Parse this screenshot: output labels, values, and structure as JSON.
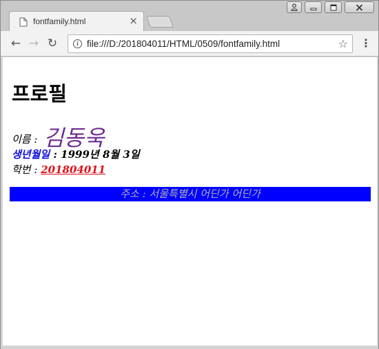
{
  "tab": {
    "title": "fontfamily.html",
    "close_icon": "close-icon"
  },
  "window_controls": {
    "profile": "person-icon",
    "minimize": "minimize-icon",
    "maximize": "maximize-icon",
    "close": "close-icon"
  },
  "toolbar": {
    "url": "file:///D:/201804011/HTML/0509/fontfamily.html",
    "back_icon": "←",
    "forward_icon": "→",
    "reload_icon": "↻",
    "info_icon": "i",
    "star_icon": "☆",
    "menu_icon": "⋮"
  },
  "page": {
    "heading": "프로필",
    "name_label": "이름 : ",
    "name_value": "김동욱",
    "birth_label": "생년월일",
    "birth_value": " : 1999년 8월 3일",
    "sid_label": "학번 : ",
    "sid_value": "201804011",
    "address": "주소 : 서울특별시 어딘가 어딘가"
  },
  "colors": {
    "name": "#6e2b91",
    "birth_label": "#1010e0",
    "student_id": "#e0101a",
    "address_background": "#0000ff",
    "address_text": "#b0b0b0"
  }
}
